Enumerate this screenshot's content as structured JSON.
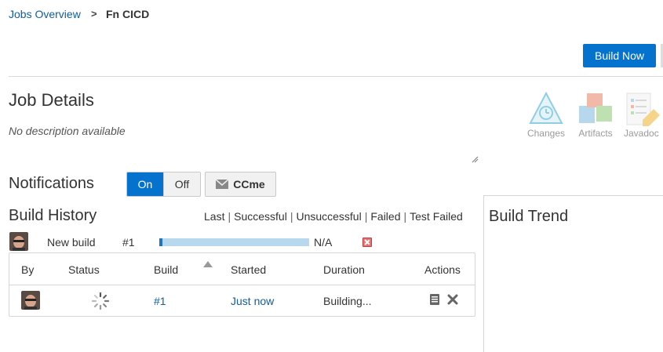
{
  "breadcrumb": {
    "parent": "Jobs Overview",
    "separator": ">",
    "current": "Fn CICD"
  },
  "toolbar": {
    "build_now_label": "Build Now"
  },
  "job_details": {
    "title": "Job Details",
    "description": "No description available"
  },
  "features": [
    {
      "label": "Changes",
      "icon": "changes-icon"
    },
    {
      "label": "Artifacts",
      "icon": "artifacts-icon"
    },
    {
      "label": "Javadoc",
      "icon": "javadoc-icon"
    }
  ],
  "notifications": {
    "label": "Notifications",
    "on_label": "On",
    "off_label": "Off",
    "selected": "On",
    "ccme_label": "CCme"
  },
  "build_history": {
    "title": "Build History",
    "filters": [
      "Last",
      "Successful",
      "Unsuccessful",
      "Failed",
      "Test Failed"
    ],
    "new_build": {
      "label": "New build",
      "number": "#1",
      "progress": 0.02,
      "eta": "N/A"
    },
    "columns": [
      "By",
      "Status",
      "Build",
      "Started",
      "Duration",
      "Actions"
    ],
    "rows": [
      {
        "build": "#1",
        "started": "Just now",
        "duration": "Building...",
        "status_icon": "spinner-icon"
      }
    ]
  },
  "build_trend": {
    "title": "Build Trend"
  },
  "colors": {
    "primary": "#0572ce",
    "link": "#0f5da6",
    "progress_track": "#b8d8ee",
    "progress_fill": "#1c74c2",
    "cancel": "#e87373"
  }
}
